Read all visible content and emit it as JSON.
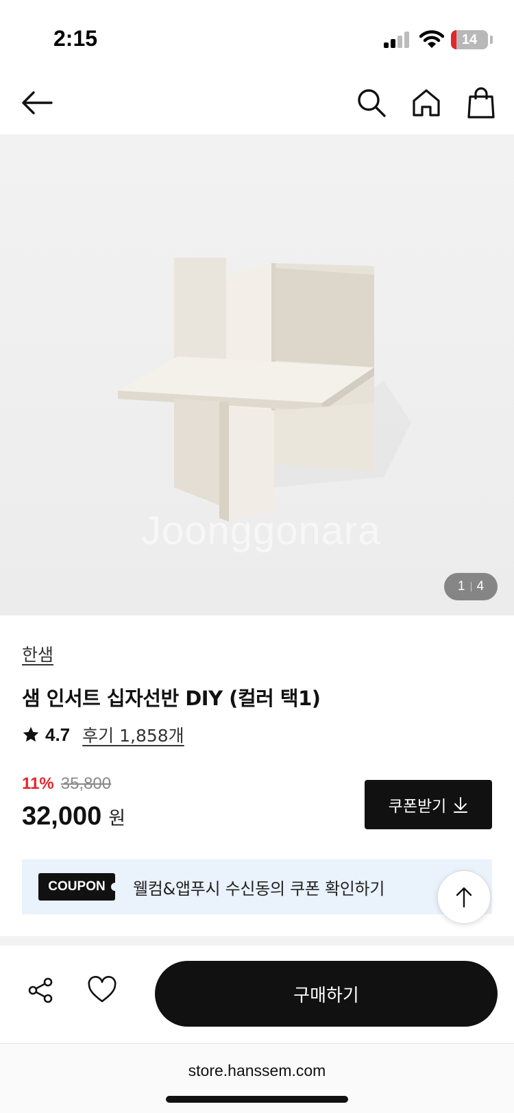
{
  "status_bar": {
    "time": "2:15",
    "battery": "14",
    "battery_level_percent": 14
  },
  "nav": {
    "icons": [
      "back-arrow-icon",
      "search-icon",
      "home-icon",
      "shopping-bag-icon"
    ]
  },
  "gallery": {
    "current": "1",
    "total": "4",
    "watermark": "Joonggonara"
  },
  "product": {
    "brand": "한샘",
    "title": "샘 인서트 십자선반 DIY (컬러 택1)",
    "rating": "4.7",
    "reviews": "후기 1,858개",
    "discount": "11%",
    "original_price": "35,800",
    "price": "32,000",
    "price_unit": "원"
  },
  "coupon_button": {
    "label": "쿠폰받기",
    "icon": "download-icon"
  },
  "coupon_banner": {
    "tag": "COUPON",
    "text": "웰컴&앱푸시 수신동의 쿠폰 확인하기"
  },
  "scroll_top": {
    "icon": "arrow-up-icon"
  },
  "bottom_bar": {
    "buy_label": "구매하기",
    "icons": [
      "share-icon",
      "heart-icon"
    ]
  },
  "browser": {
    "url": "store.hanssem.com"
  }
}
